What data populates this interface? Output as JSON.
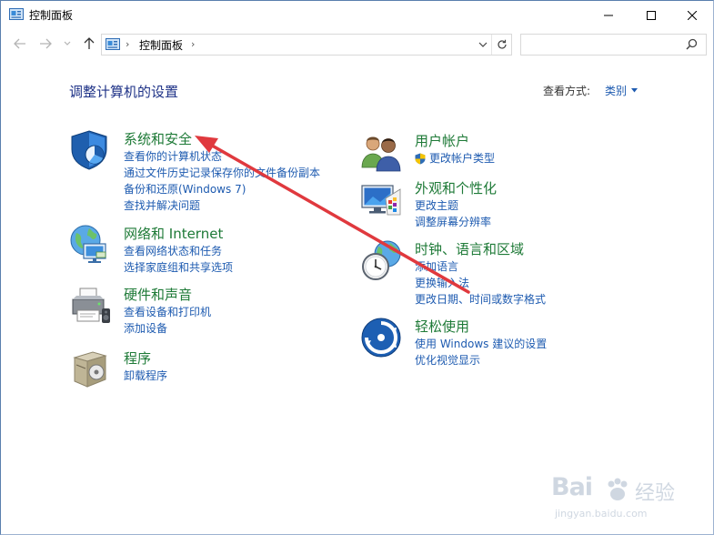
{
  "window": {
    "title": "控制面板"
  },
  "address": {
    "location": "控制面板",
    "separator": "›"
  },
  "search": {
    "placeholder": ""
  },
  "main": {
    "heading": "调整计算机的设置",
    "view_by_label": "查看方式:",
    "view_by_value": "类别"
  },
  "categories_left": [
    {
      "title": "系统和安全",
      "icon": "shield-icon",
      "links": [
        "查看你的计算机状态",
        "通过文件历史记录保存你的文件备份副本",
        "备份和还原(Windows 7)",
        "查找并解决问题"
      ]
    },
    {
      "title": "网络和 Internet",
      "icon": "globe-network-icon",
      "links": [
        "查看网络状态和任务",
        "选择家庭组和共享选项"
      ]
    },
    {
      "title": "硬件和声音",
      "icon": "printer-icon",
      "links": [
        "查看设备和打印机",
        "添加设备"
      ]
    },
    {
      "title": "程序",
      "icon": "programs-icon",
      "links": [
        "卸载程序"
      ]
    }
  ],
  "categories_right": [
    {
      "title": "用户帐户",
      "icon": "users-icon",
      "links": [
        "更改帐户类型"
      ]
    },
    {
      "title": "外观和个性化",
      "icon": "monitor-palette-icon",
      "links": [
        "更改主题",
        "调整屏幕分辨率"
      ]
    },
    {
      "title": "时钟、语言和区域",
      "icon": "clock-globe-icon",
      "links": [
        "添加语言",
        "更换输入法",
        "更改日期、时间或数字格式"
      ]
    },
    {
      "title": "轻松使用",
      "icon": "ease-of-access-icon",
      "links": [
        "使用 Windows 建议的设置",
        "优化视觉显示"
      ]
    }
  ],
  "watermark": {
    "brand": "Bai",
    "brand2": "经验",
    "url": "jingyan.baidu.com"
  },
  "colors": {
    "link": "#1e5bb0",
    "category": "#1e7a37",
    "heading": "#1e3287",
    "arrow": "#e0393e"
  }
}
